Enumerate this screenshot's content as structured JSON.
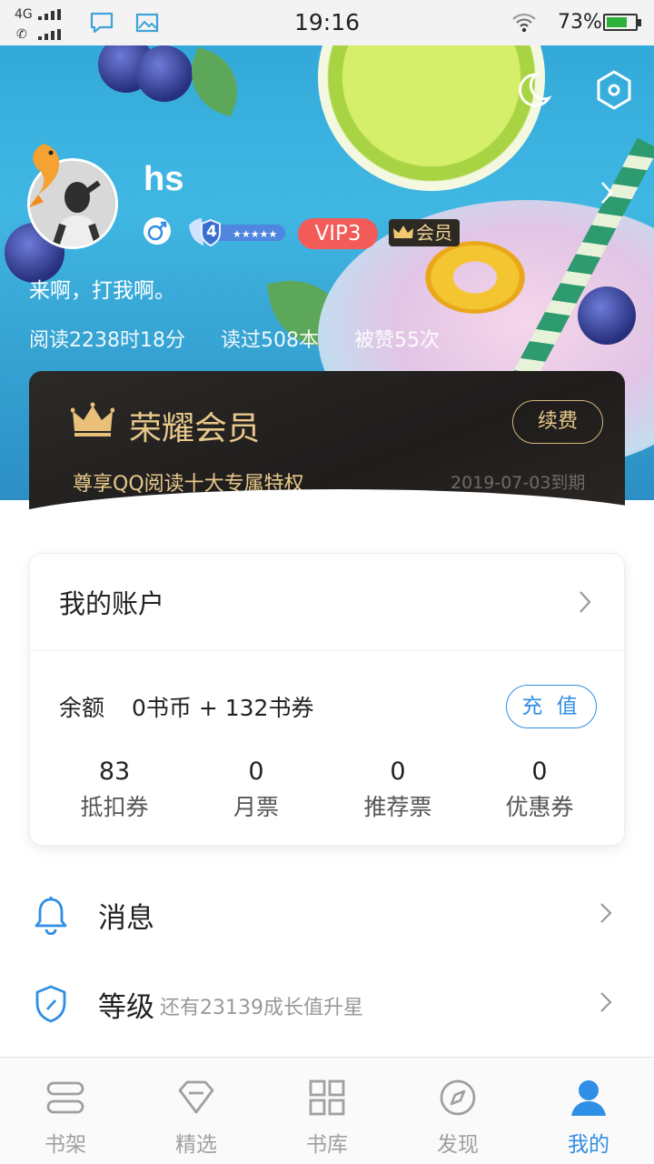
{
  "status_bar": {
    "network": "4G",
    "time": "19:16",
    "battery": "73%",
    "battery_level": 0.73
  },
  "profile": {
    "username": "hs",
    "level": "4",
    "vip": "VIP3",
    "member": "会员",
    "signature": "来啊，打我啊。",
    "stats": [
      "阅读2238时18分",
      "读过508本",
      "被赞55次"
    ]
  },
  "honor": {
    "title": "荣耀会员",
    "renew": "续费",
    "desc": "尊享QQ阅读十大专属特权",
    "expiry": "2019-07-03到期"
  },
  "account": {
    "title": "我的账户",
    "balance_label": "余额",
    "balance_value": "0书币 + 132书券",
    "recharge": "充 值",
    "stats": [
      {
        "value": "83",
        "label": "抵扣券"
      },
      {
        "value": "0",
        "label": "月票"
      },
      {
        "value": "0",
        "label": "推荐票"
      },
      {
        "value": "0",
        "label": "优惠券"
      }
    ]
  },
  "list": {
    "messages": {
      "label": "消息"
    },
    "level": {
      "label": "等级",
      "sub": "还有23139成长值升星"
    }
  },
  "nav": [
    {
      "label": "书架",
      "icon": "bookshelf-icon"
    },
    {
      "label": "精选",
      "icon": "diamond-icon"
    },
    {
      "label": "书库",
      "icon": "grid-icon"
    },
    {
      "label": "发现",
      "icon": "compass-icon"
    },
    {
      "label": "我的",
      "icon": "person-icon",
      "active": true
    }
  ],
  "colors": {
    "accent": "#2f8ee5",
    "gold": "#e8c88a",
    "vip_red": "#f25b58"
  }
}
